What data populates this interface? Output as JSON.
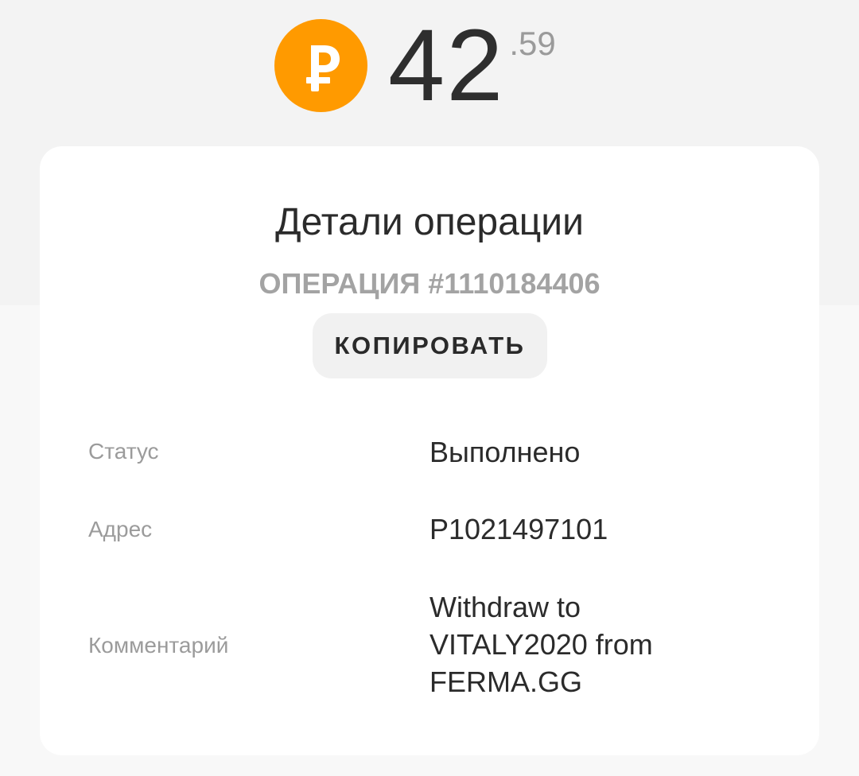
{
  "balance": {
    "currency_icon": "ruble-coin-icon",
    "amount_int": "42",
    "amount_dec": ".59",
    "coin_color": "#ff9a00"
  },
  "details": {
    "title": "Детали операции",
    "operation": "ОПЕРАЦИЯ #1110184406",
    "copy_label": "КОПИРОВАТЬ",
    "rows": [
      {
        "label": "Статус",
        "value": "Выполнено"
      },
      {
        "label": "Адрес",
        "value": "P1021497101"
      },
      {
        "label": "Комментарий",
        "value": "Withdraw to VITALY2020 from FERMA.GG"
      }
    ]
  }
}
